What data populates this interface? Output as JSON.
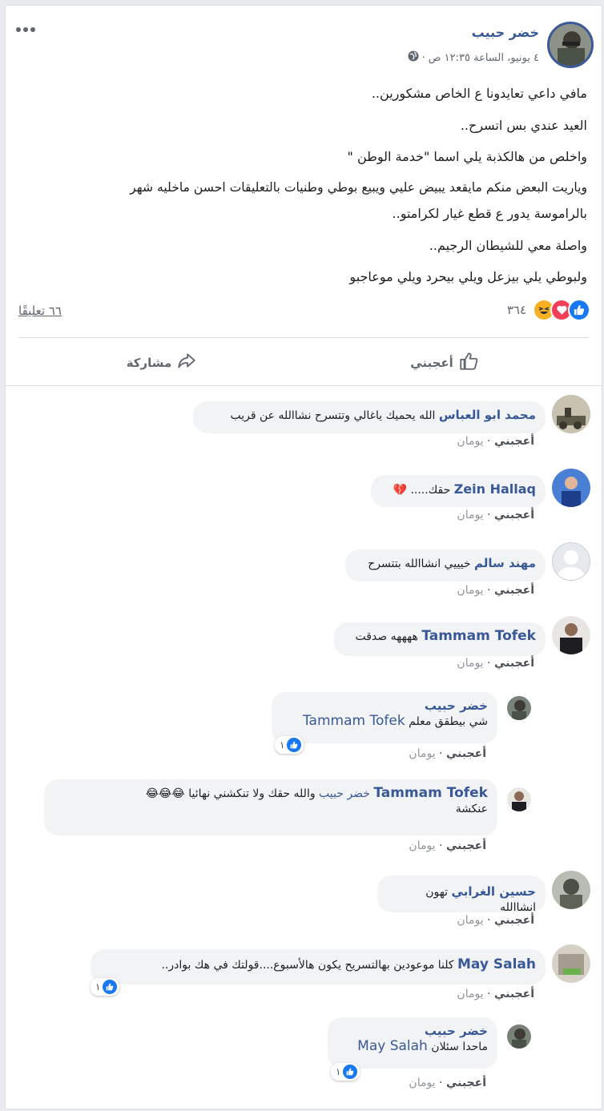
{
  "post": {
    "author": "خضر حبيب",
    "timestamp": "٤ يونيو، الساعة ١٢:٣٥ ص",
    "separator": "·",
    "lines": [
      "مافي داعي تعايدونا ع الخاص مشكورين..",
      "العيد عندي بس اتسرح..",
      "واخلص من هالكذبة يلي اسما \"خدمة الوطن \"",
      "وياريت البعض منكم مايقعد يبيض عليي ويبيع بوطي وطنيات بالتعليقات احسن ماخليه شهر",
      "بالراموسة يدور ع قطع غيار لكرامتو..",
      "واصلة معي للشيطان الرجيم..",
      "ولبوطي يلي بيزعل ويلي بيحرد ويلي موعاجبو"
    ],
    "reactions_count": "٣٦٤",
    "comments_count": "٦٦ تعليقًا",
    "more_icon": "more-horizontal-icon",
    "privacy_icon": "globe-icon"
  },
  "actions": {
    "like_label": "أعجبني",
    "share_label": "مشاركة"
  },
  "comment_meta": {
    "like": "أعجبني",
    "dot": "·",
    "time": "يومان"
  },
  "comments": [
    {
      "name": "محمد ابو العباس",
      "text": "الله يحميك ياغالي وتتسرح نشاالله عن قريب"
    },
    {
      "name": "Zein Hallaq",
      "text": "حقك.....",
      "emoji": "💔"
    },
    {
      "name": "مهند سالم",
      "text": "خيييي انشاالله بتتسرح"
    },
    {
      "name": "Tammam Tofek",
      "text": "ههههه صدقت"
    },
    {
      "name": "خضر حبيب",
      "mention": "Tammam Tofek",
      "text": "شي بيطقق معلم",
      "reactions": "١"
    },
    {
      "name": "Tammam Tofek",
      "mention": "خضر حبيب",
      "text": "والله حقك ولا تنكشني نهائيا",
      "emoji": "😂😂😂",
      "text2": "عنكشة"
    },
    {
      "name": "حسين الغرابي",
      "text": "تهون انشاالله"
    },
    {
      "name": "May Salah",
      "text": "كلنا موعودين بهالتسريح يكون هالأسبوع....قولتك في هك بوادر..",
      "reactions": "١"
    },
    {
      "name": "خضر حبيب",
      "mention": "May Salah",
      "text": "ماحدا سئلان",
      "reactions": "١"
    }
  ],
  "colors": {
    "link": "#385898",
    "like_blue": "#1877f2",
    "bubble": "#f2f3f5"
  }
}
